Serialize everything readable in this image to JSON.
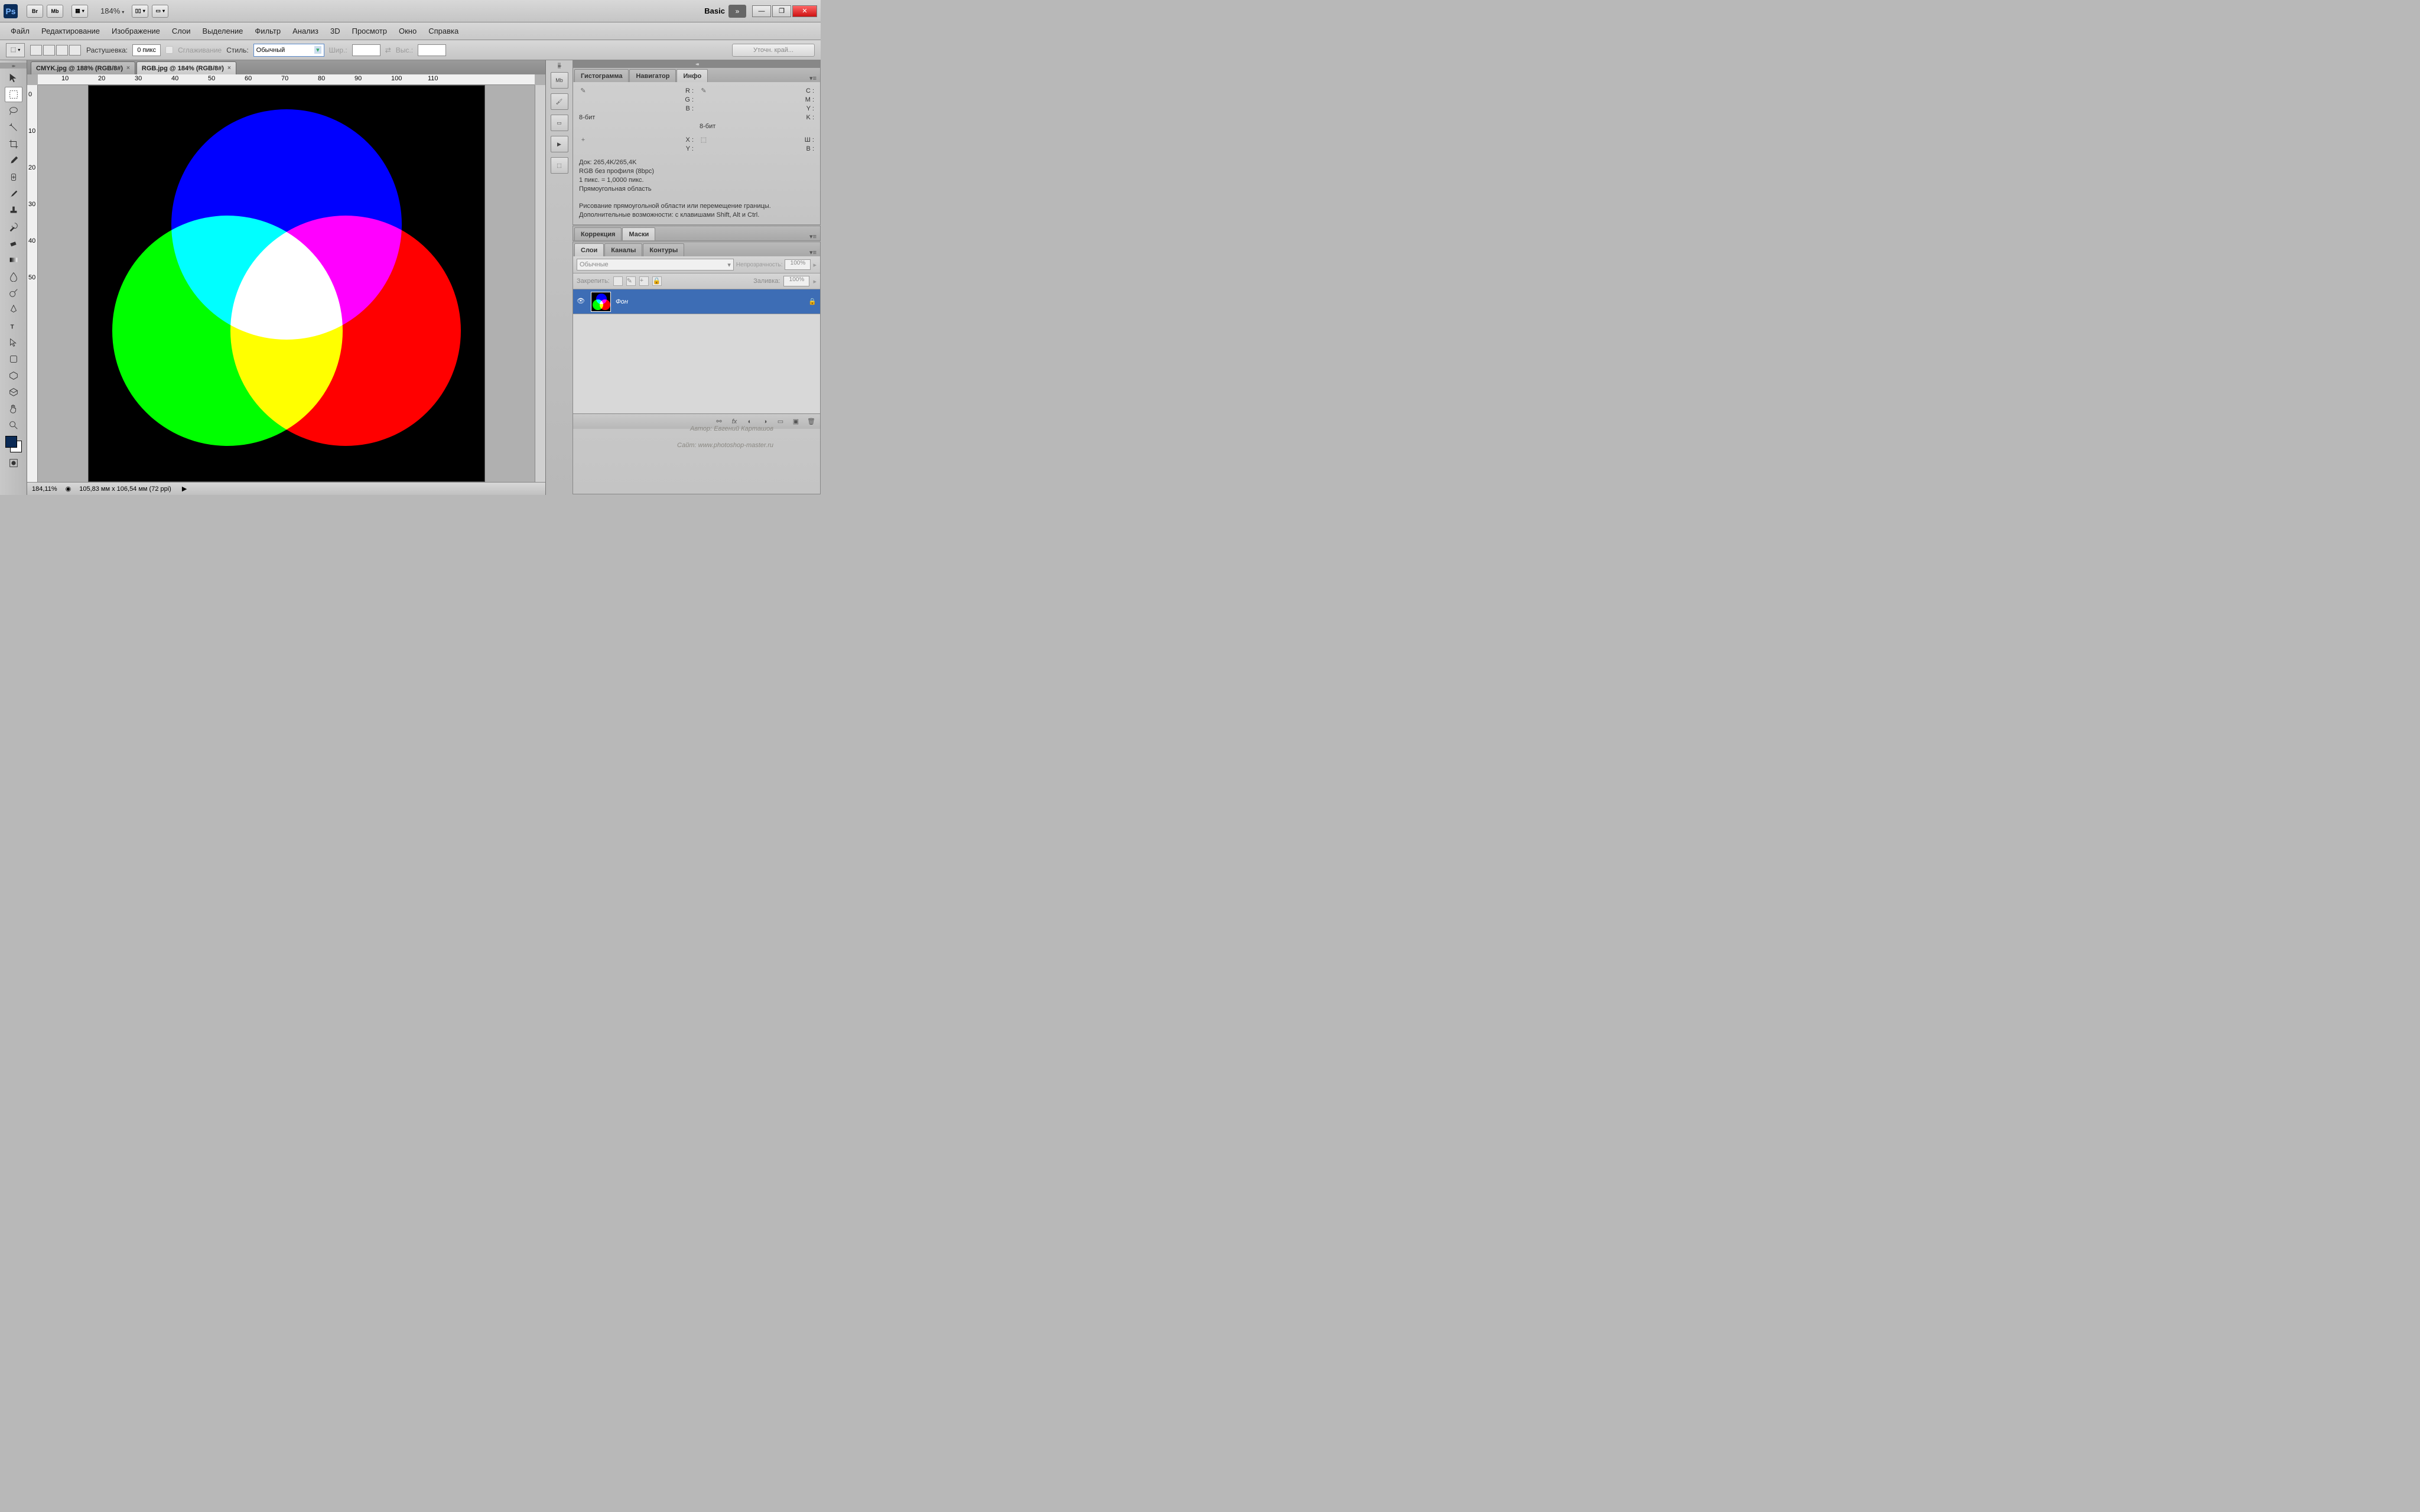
{
  "titlebar": {
    "workspace": "Basic",
    "zoom_display": "184%"
  },
  "menu": [
    "Файл",
    "Редактирование",
    "Изображение",
    "Слои",
    "Выделение",
    "Фильтр",
    "Анализ",
    "3D",
    "Просмотр",
    "Окно",
    "Справка"
  ],
  "options": {
    "feather_label": "Растушевка:",
    "feather_value": "0 пикс",
    "antialias_label": "Сглаживание",
    "style_label": "Стиль:",
    "style_value": "Обычный",
    "width_label": "Шир.:",
    "height_label": "Выс.:",
    "refine_label": "Уточн. край..."
  },
  "tabs": [
    {
      "label": "CMYK.jpg @ 188% (RGB/8#)",
      "active": false
    },
    {
      "label": "RGB.jpg @ 184% (RGB/8#)",
      "active": true
    }
  ],
  "ruler_h": [
    "10",
    "20",
    "30",
    "40",
    "50",
    "60",
    "70",
    "80",
    "90",
    "100",
    "110"
  ],
  "ruler_v": [
    "0",
    "10",
    "20",
    "30",
    "40",
    "50"
  ],
  "status": {
    "zoom": "184,11%",
    "dims": "105,83 мм x 106,54 мм (72 ppi)"
  },
  "info_panel": {
    "tabs": [
      "Гистограмма",
      "Навигатор",
      "Инфо"
    ],
    "active_tab": 2,
    "rgb": {
      "r": "R :",
      "g": "G :",
      "b": "B :"
    },
    "cmyk": {
      "c": "C :",
      "m": "M :",
      "y": "Y :",
      "k": "K :"
    },
    "bit1": "8-бит",
    "bit2": "8-бит",
    "xy": {
      "x": "X :",
      "y": "Y :"
    },
    "wh": {
      "w": "Ш :",
      "h": "В :"
    },
    "doc": "Док: 265,4K/265,4K",
    "profile": "RGB без профиля (8bpc)",
    "pixel": "1 пикс. = 1,0000 пикс.",
    "shape": "Прямоугольная область",
    "hint1": "Рисование прямоугольной области или перемещение границы.",
    "hint2": "Дополнительные возможности: с клавишами Shift, Alt и Ctrl."
  },
  "mid_panel": {
    "tabs": [
      "Коррекция",
      "Маски"
    ],
    "active_tab": 1
  },
  "layers_panel": {
    "tabs": [
      "Слои",
      "Каналы",
      "Контуры"
    ],
    "active_tab": 0,
    "blend": "Обычные",
    "opacity_label": "Непрозрачность:",
    "opacity_value": "100%",
    "lock_label": "Закрепить:",
    "fill_label": "Заливка:",
    "fill_value": "100%",
    "layer_name": "Фон"
  },
  "watermark": {
    "line1": "Автор: Евгений Карташов",
    "line2": "Сайт: www.photoshop-master.ru"
  }
}
